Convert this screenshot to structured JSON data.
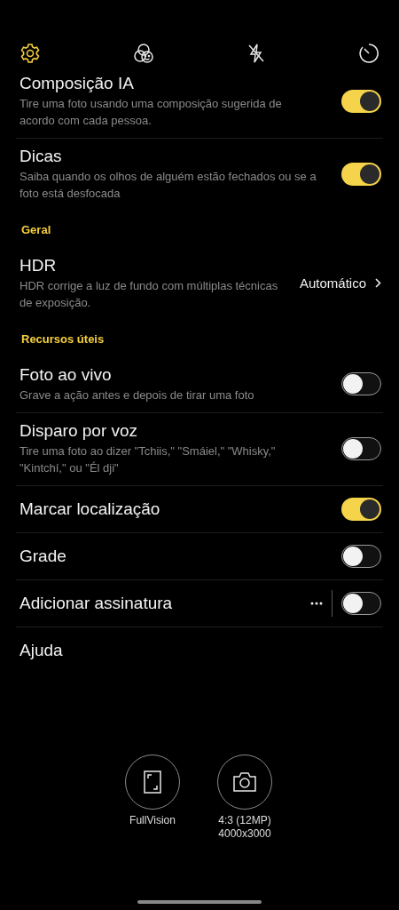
{
  "toolbar": {
    "items": [
      {
        "selected": true
      },
      {
        "selected": false
      },
      {
        "selected": false
      },
      {
        "selected": false
      }
    ]
  },
  "settings": [
    {
      "kind": "toggle",
      "title": "Composição IA",
      "description": "Tire uma foto usando uma composição sugerida de acordo com cada pessoa.",
      "on": true
    },
    {
      "kind": "toggle",
      "title": "Dicas",
      "description": "Saiba quando os olhos de alguém estão fechados ou se a foto está desfocada",
      "on": true
    },
    {
      "kind": "header",
      "title": "Geral"
    },
    {
      "kind": "value",
      "title": "HDR",
      "description": "HDR corrige a luz de fundo com múltiplas técnicas de exposição.",
      "value": "Automático"
    },
    {
      "kind": "header",
      "title": "Recursos úteis"
    },
    {
      "kind": "toggle",
      "title": "Foto ao vivo",
      "description": "Grave a ação antes e depois de tirar uma foto",
      "on": false
    },
    {
      "kind": "toggle",
      "title": "Disparo por voz",
      "description": "Tire uma foto ao dizer \"Tchiis,\" \"Smáiel,\" \"Whisky,\" \"Kintchí,\" ou \"Él dji\"",
      "on": false
    },
    {
      "kind": "toggle",
      "title": "Marcar localização",
      "on": true
    },
    {
      "kind": "toggle",
      "title": "Grade",
      "on": false
    },
    {
      "kind": "toggle-more",
      "title": "Adicionar assinatura",
      "on": false
    },
    {
      "kind": "link",
      "title": "Ajuda"
    }
  ],
  "shot_options": [
    {
      "label": "FullVision"
    },
    {
      "label": "4:3 (12MP)\n4000x3000"
    }
  ]
}
